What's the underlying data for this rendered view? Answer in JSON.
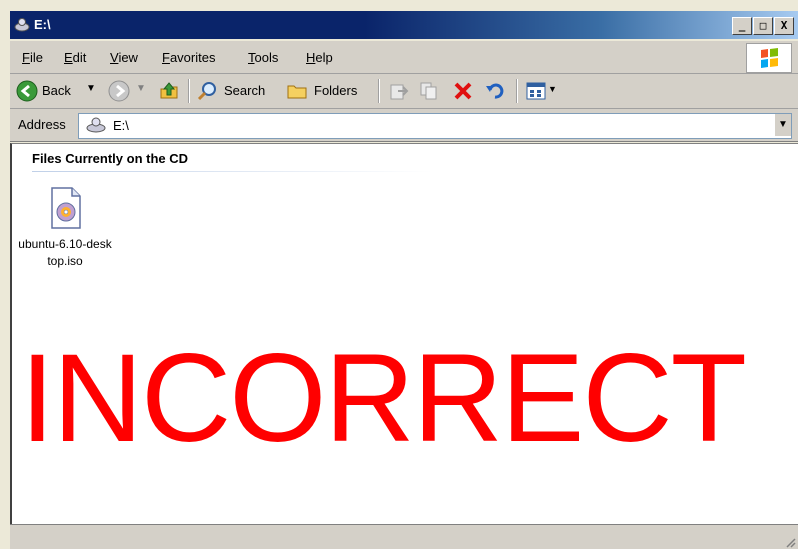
{
  "window": {
    "title": "E:\\"
  },
  "title_buttons": {
    "minimize": "_",
    "maximize": "□",
    "close": "X"
  },
  "menu": {
    "items": [
      "File",
      "Edit",
      "View",
      "Favorites",
      "Tools",
      "Help"
    ]
  },
  "toolbar": {
    "back_label": "Back",
    "search_label": "Search",
    "folders_label": "Folders"
  },
  "address": {
    "label": "Address",
    "value": "E:\\"
  },
  "content": {
    "group_header": "Files Currently on the CD",
    "files": [
      {
        "name": "ubuntu-6.10-desktop.iso",
        "icon": "disc-image-icon"
      }
    ]
  },
  "overlay": {
    "stamp_text": "INCORRECT",
    "stamp_color": "#ff0000"
  },
  "colors": {
    "titlebar": "#0a246a",
    "chrome": "#d4d0c8"
  }
}
